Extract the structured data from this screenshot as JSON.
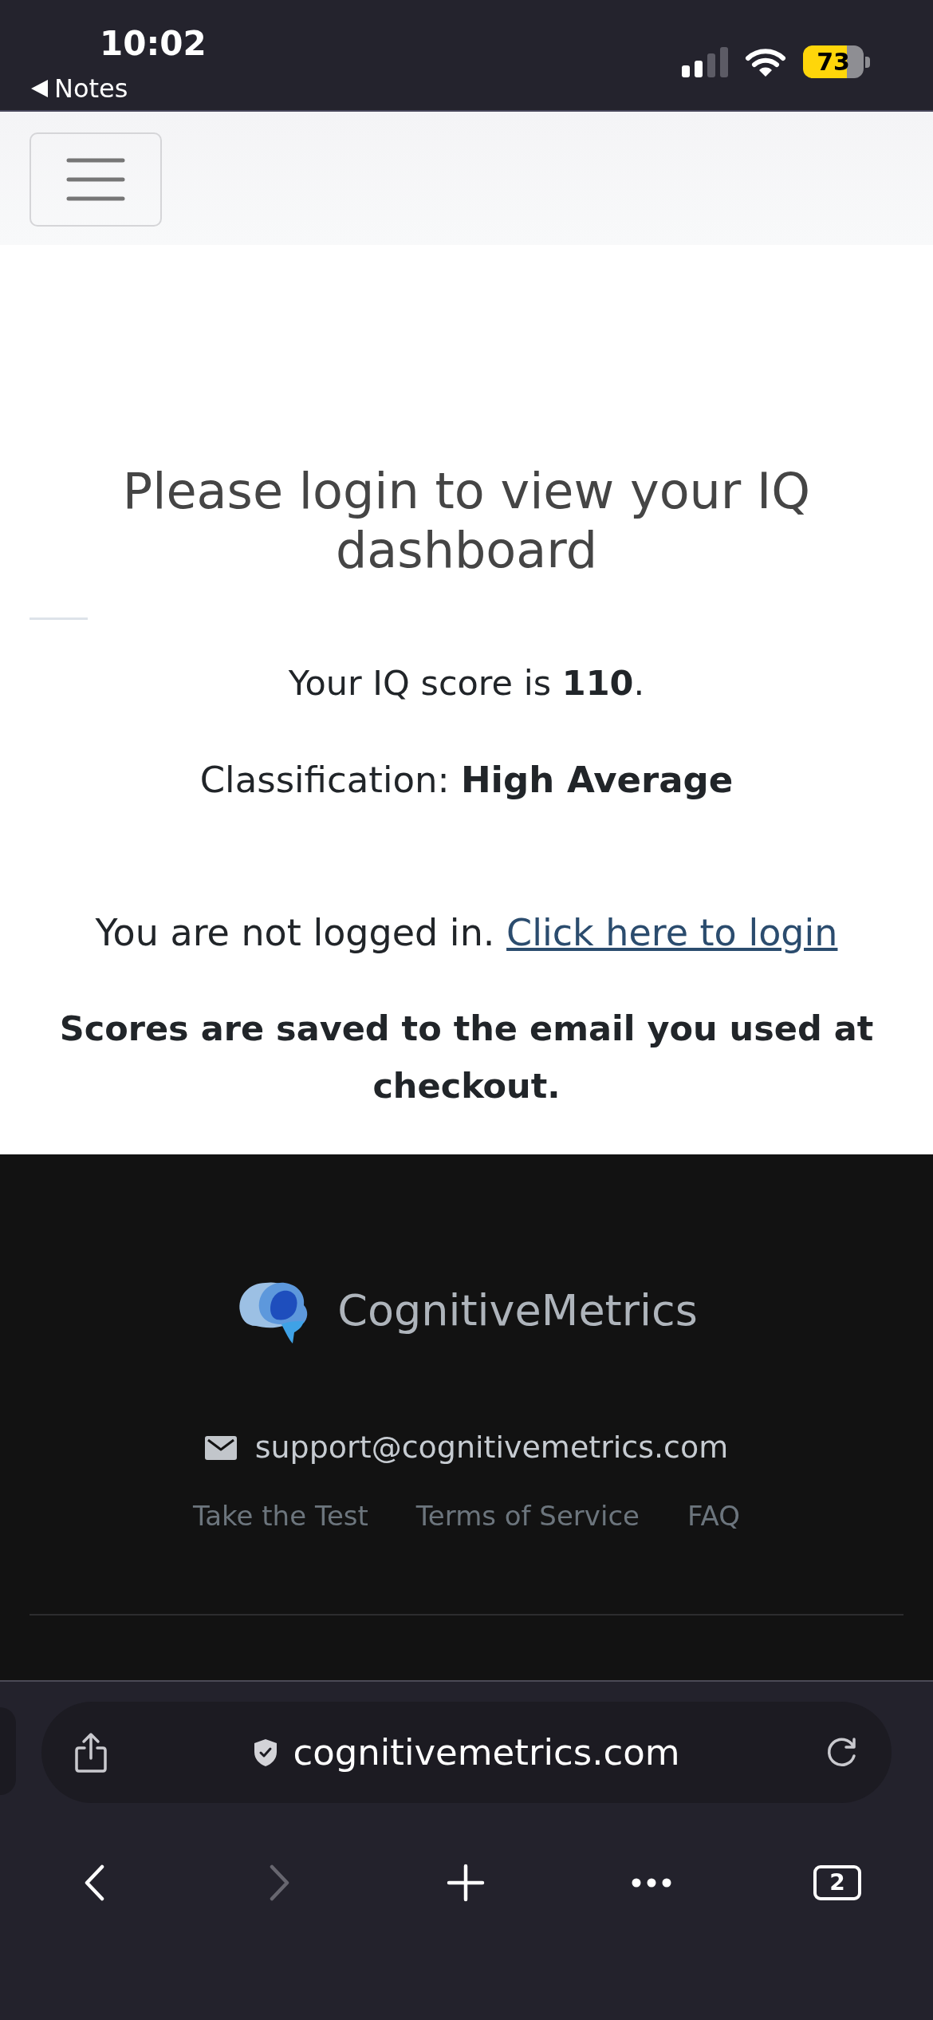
{
  "status_bar": {
    "time": "10:02",
    "back_app": "Notes",
    "battery": "73"
  },
  "main": {
    "heading": "Please login to view your IQ dashboard",
    "score": "Your IQ score is **110**.",
    "classification": "Classification: **High Average**",
    "login_prompt": {
      "text": "You are not logged in.",
      "link": "Click here to login"
    },
    "note": "Scores are saved to the email you used at checkout."
  },
  "footer": {
    "brand": "CognitiveMetrics",
    "email": "support@cognitivemetrics.com",
    "links": [
      "Take the Test",
      "Terms of Service",
      "FAQ"
    ]
  },
  "browser": {
    "url": "cognitivemetrics.com",
    "buttons": [
      {
        "kind": "back",
        "disabled": false
      },
      {
        "kind": "forward",
        "disabled": true
      },
      {
        "kind": "new_tab",
        "disabled": false
      },
      {
        "kind": "more",
        "disabled": false
      },
      {
        "kind": "tabs",
        "label": "2",
        "disabled": false
      }
    ]
  }
}
